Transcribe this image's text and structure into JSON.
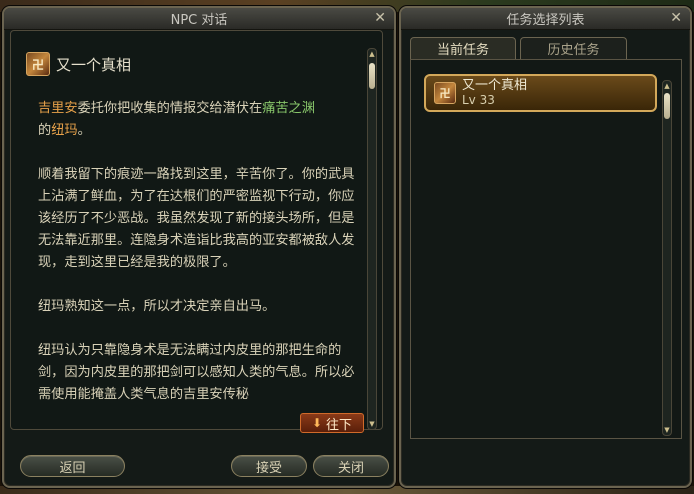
{
  "npc_window": {
    "title": "NPC 对话",
    "close_icon": "✕",
    "quest_title": "又一个真相",
    "quest_icon_glyph": "卍",
    "dialog": {
      "intro": {
        "npc_name": "吉里安",
        "text1": "委托你把收集的情报交给潜伏在",
        "place": "痛苦之渊",
        "text2": "的",
        "target": "纽玛",
        "text3": "。"
      },
      "paragraphs": [
        "顺着我留下的痕迹一路找到这里，辛苦你了。你的武具上沾满了鲜血，为了在达根们的严密监视下行动，你应该经历了不少恶战。我虽然发现了新的接头场所，但是无法靠近那里。连隐身术造诣比我高的亚安都被敌人发现，走到这里已经是我的极限了。",
        "纽玛熟知这一点，所以才决定亲自出马。",
        "纽玛认为只靠隐身术是无法瞒过内皮里的那把生命的剑，因为内皮里的那把剑可以感知人类的气息。所以必需使用能掩盖人类气息的吉里安传秘"
      ]
    },
    "next_button": "往下",
    "buttons": {
      "back": "返回",
      "accept": "接受",
      "close": "关闭"
    }
  },
  "quest_window": {
    "title": "任务选择列表",
    "close_icon": "✕",
    "tabs": [
      "当前任务",
      "历史任务"
    ],
    "active_tab": 0,
    "quests": [
      {
        "name": "又一个真相",
        "level": "Lv 33"
      }
    ]
  },
  "colors": {
    "highlight_orange": "#e8a24a",
    "highlight_green": "#88c66a",
    "gold_border": "#d3a85a"
  }
}
